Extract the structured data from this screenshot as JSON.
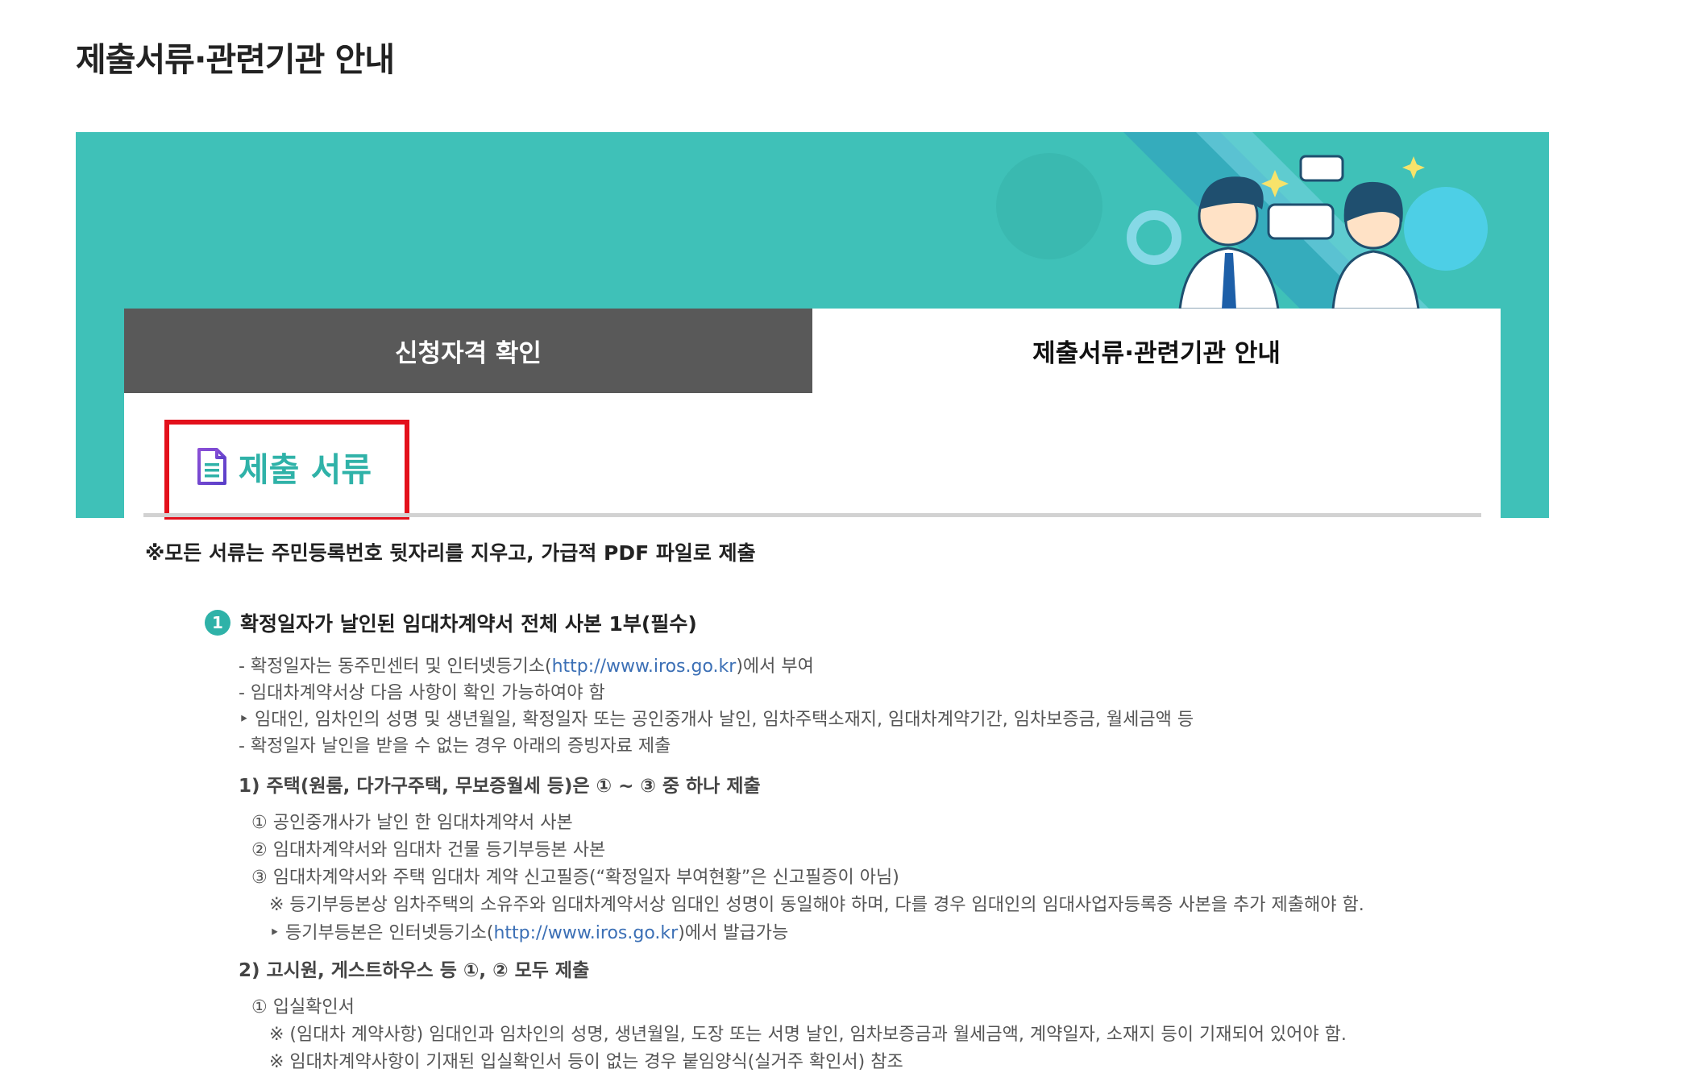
{
  "page": {
    "title": "제출서류·관련기관 안내"
  },
  "tabs": [
    {
      "label": "신청자격 확인",
      "active": false
    },
    {
      "label": "제출서류·관련기관 안내",
      "active": true
    }
  ],
  "section": {
    "title": "제출 서류",
    "icon": "document-icon"
  },
  "notice": "※모든 서류는 주민등록번호 뒷자리를 지우고, 가급적 PDF 파일로 제출",
  "item1": {
    "number": "1",
    "title": "확정일자가 날인된 임대차계약서 전체 사본 1부(필수)",
    "lines": {
      "l1_pre": "- 확정일자는 동주민센터 및 인터넷등기소(",
      "l1_link": "http://www.iros.go.kr",
      "l1_post": ")에서 부여",
      "l2": "- 임대차계약서상 다음 사항이 확인 가능하여야 함",
      "l3": "‣ 임대인, 임차인의 성명 및 생년월일, 확정일자 또는 공인중개사 날인, 임차주택소재지, 임대차계약기간, 임차보증금, 월세금액 등",
      "l4": "- 확정일자 날인을 받을 수 없는 경우 아래의 증빙자료 제출"
    },
    "sub1": {
      "title": "1) 주택(원룸, 다가구주택, 무보증월세 등)은 ① ~ ③ 중 하나 제출",
      "a": "① 공인중개사가 날인 한 임대차계약서 사본",
      "b": "② 임대차계약서와 임대차 건물 등기부등본 사본",
      "c": "③ 임대차계약서와 주택 임대차 계약 신고필증(“확정일자 부여현황”은 신고필증이 아님)",
      "note1": "※ 등기부등본상 임차주택의 소유주와 임대차계약서상 임대인 성명이 동일해야 하며, 다를 경우 임대인의 임대사업자등록증 사본을 추가 제출해야 함.",
      "note2_pre": "‣ 등기부등본은 인터넷등기소(",
      "note2_link": "http://www.iros.go.kr",
      "note2_post": ")에서 발급가능"
    },
    "sub2": {
      "title": "2) 고시원, 게스트하우스 등 ①, ② 모두 제출",
      "a": "① 입실확인서",
      "note1": "※ (임대차 계약사항) 임대인과 임차인의 성명, 생년월일, 도장 또는 서명 날인, 임차보증금과 월세금액, 계약일자, 소재지 등이 기재되어 있어야 함.",
      "note2": "※ 임대차계약사항이 기재된 입실확인서 등이 없는 경우 붙임양식(실거주 확인서) 참조"
    }
  },
  "colors": {
    "banner": "#3fc1b8",
    "accent": "#2fb2a8",
    "tab_inactive": "#595959",
    "highlight": "#e3101b",
    "link": "#3b6fb5"
  }
}
